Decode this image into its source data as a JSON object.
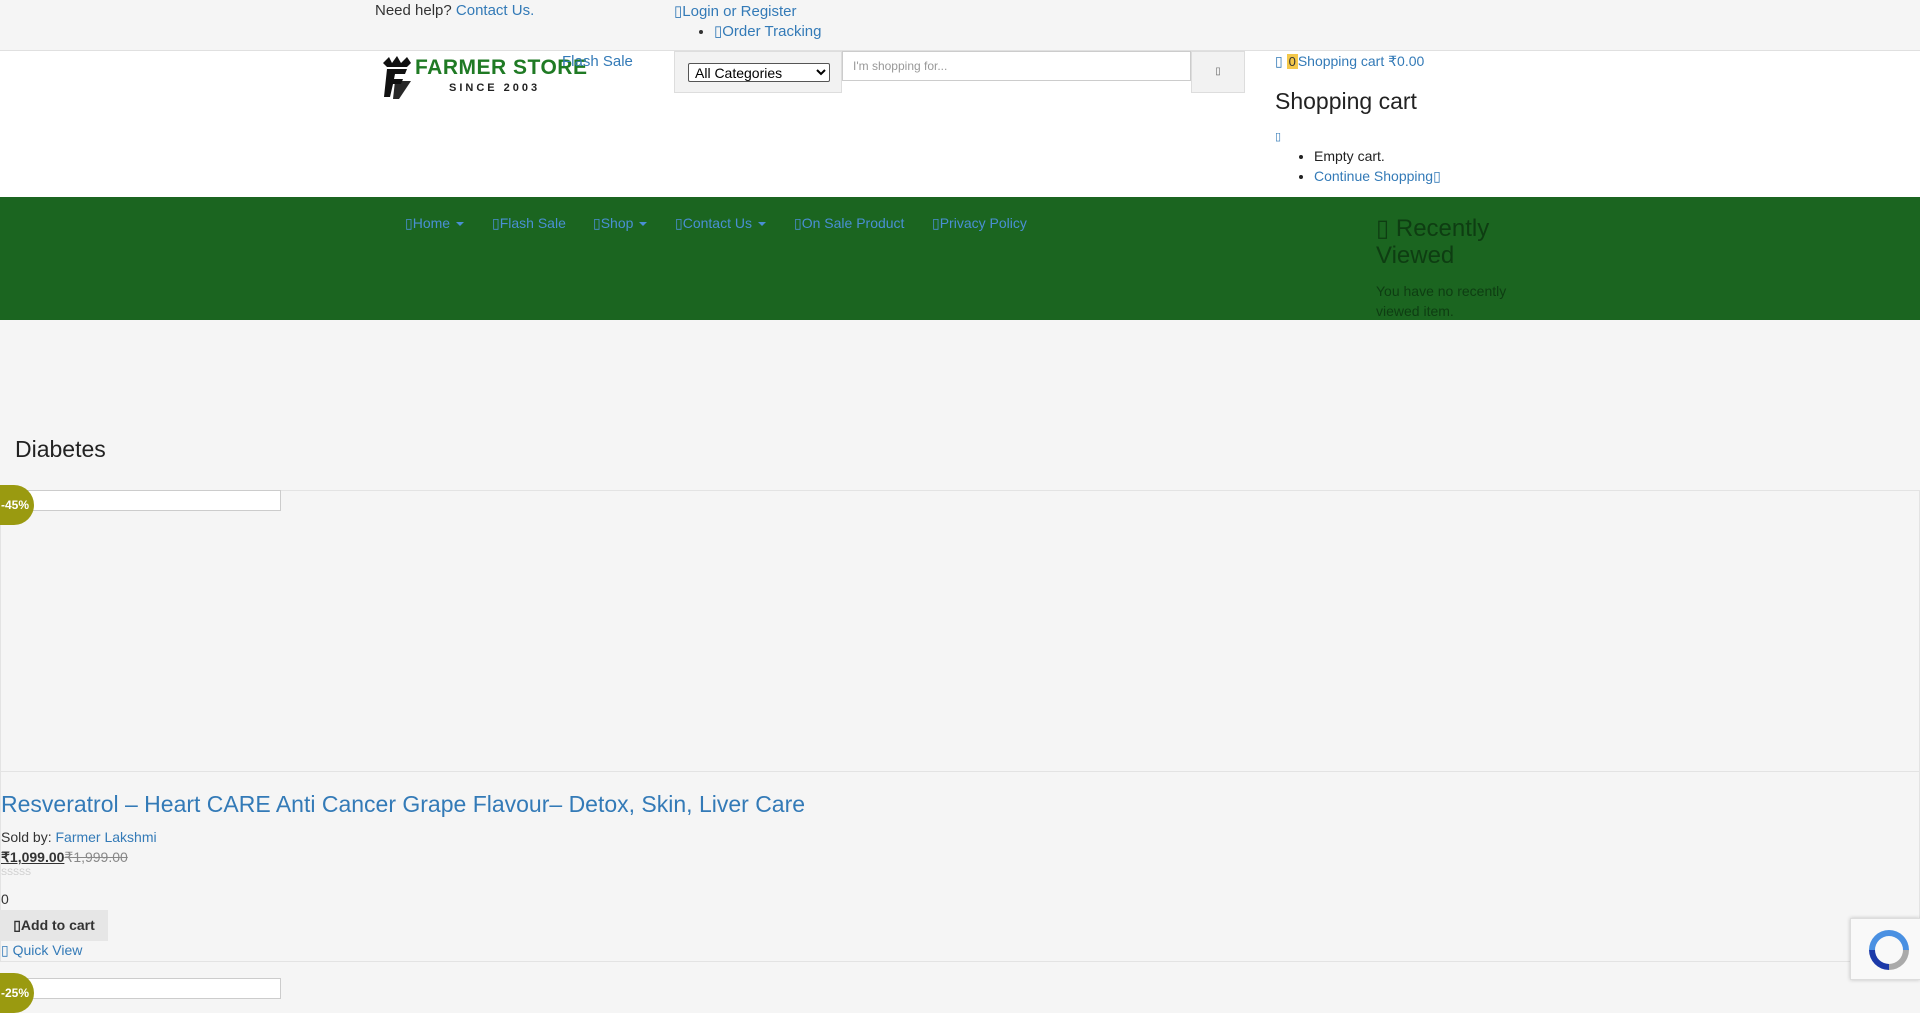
{
  "topbar": {
    "help_text": "Need help?",
    "contact_link": "Contact Us.",
    "login_link": "Login or Register",
    "order_tracking": "Order Tracking"
  },
  "header": {
    "logo_text": "FARMER STORE",
    "logo_sub": "SINCE 2003",
    "flash_sale_img_alt": "Flash Sale",
    "category_selected": "All Categories",
    "search_placeholder": "I'm shopping for...",
    "cart": {
      "count": "0",
      "label": "Shopping cart",
      "amount": "₹0.00",
      "title": "Shopping cart",
      "empty_text": "Empty cart.",
      "continue_link": "Continue Shopping"
    }
  },
  "nav": {
    "items": [
      {
        "label": "Home",
        "dropdown": true
      },
      {
        "label": "Flash Sale",
        "dropdown": false
      },
      {
        "label": "Shop",
        "dropdown": true
      },
      {
        "label": "Contact Us",
        "dropdown": true
      },
      {
        "label": "On Sale Product",
        "dropdown": false
      },
      {
        "label": "Privacy Policy",
        "dropdown": false
      }
    ],
    "recently_viewed_title": "Recently Viewed",
    "recently_viewed_text": "You have no recently viewed item."
  },
  "page": {
    "title": "Diabetes"
  },
  "products": [
    {
      "badge": "-45%",
      "title": "Resveratrol – Heart CARE Anti Cancer Grape Flavour– Detox, Skin, Liver Care",
      "sold_by_label": "Sold by:",
      "seller": "Farmer Lakshmi",
      "price_now": "₹1,099.00",
      "price_old": "₹1,999.00",
      "stars": "SSSSS",
      "rating_count": "0",
      "add_to_cart": "Add to cart",
      "quick_view": "Quick View"
    },
    {
      "badge": "-25%"
    }
  ],
  "colors": {
    "nav_bg": "#1b6520",
    "link": "#337ab7",
    "badge": "#9a9a10",
    "cart_badge": "#f4c84a"
  },
  "icons": {
    "login": "user-icon",
    "tracking": "truck-icon",
    "cart": "bag-icon",
    "search": "search-icon"
  }
}
